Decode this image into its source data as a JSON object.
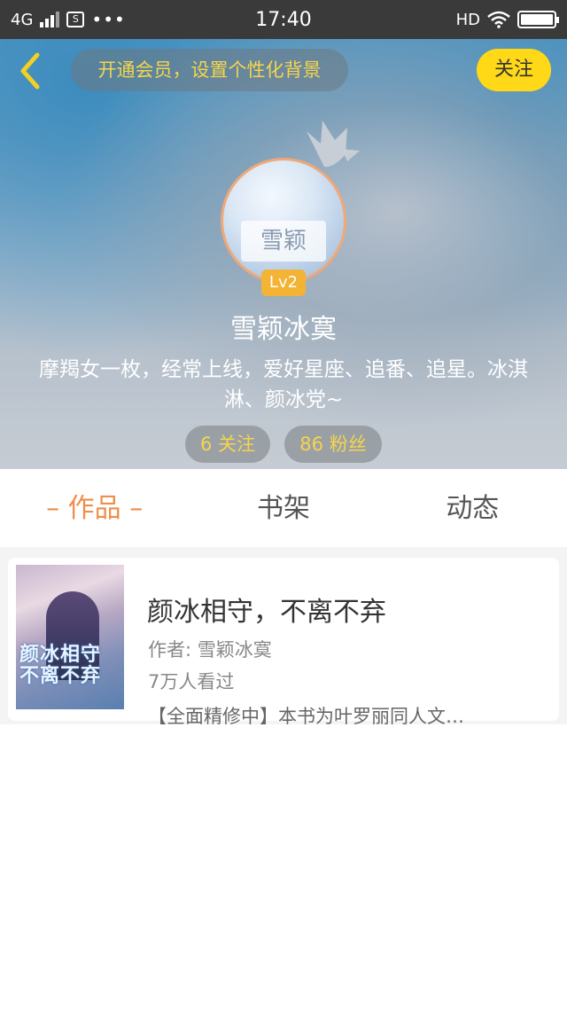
{
  "status_bar": {
    "network": "4G",
    "time": "17:40",
    "hd": "HD",
    "app_icon": "S",
    "more": "•••"
  },
  "header": {
    "vip_prompt": "开通会员，设置个性化背景",
    "follow_label": "关注",
    "level": "Lv2",
    "avatar_text": "雪颖",
    "username": "雪颖冰寞",
    "bio_line1": "摩羯女一枚，经常上线，爱好星座、追番、追星。冰淇",
    "bio_line2": "淋、颜冰党~",
    "following": "6 关注",
    "followers": "86 粉丝",
    "accent_color": "#f6d54a",
    "button_color": "#ffd918"
  },
  "tabs": [
    {
      "label": "– 作品 –",
      "active": true
    },
    {
      "label": "书架",
      "active": false
    },
    {
      "label": "动态",
      "active": false
    }
  ],
  "tab_active_color": "#ef8d4a",
  "books": [
    {
      "title": "颜冰相守，不离不弃",
      "author": "作者: 雪颖冰寞",
      "views": "7万人看过",
      "description": "【全面精修中】本书为叶罗丽同人文…",
      "cover_text": "颜冰相守 不离不弃"
    }
  ],
  "icons": {
    "back": "back-arrow-icon",
    "crown": "crown-icon",
    "wifi": "wifi-icon",
    "battery": "battery-icon",
    "signal": "signal-icon"
  }
}
